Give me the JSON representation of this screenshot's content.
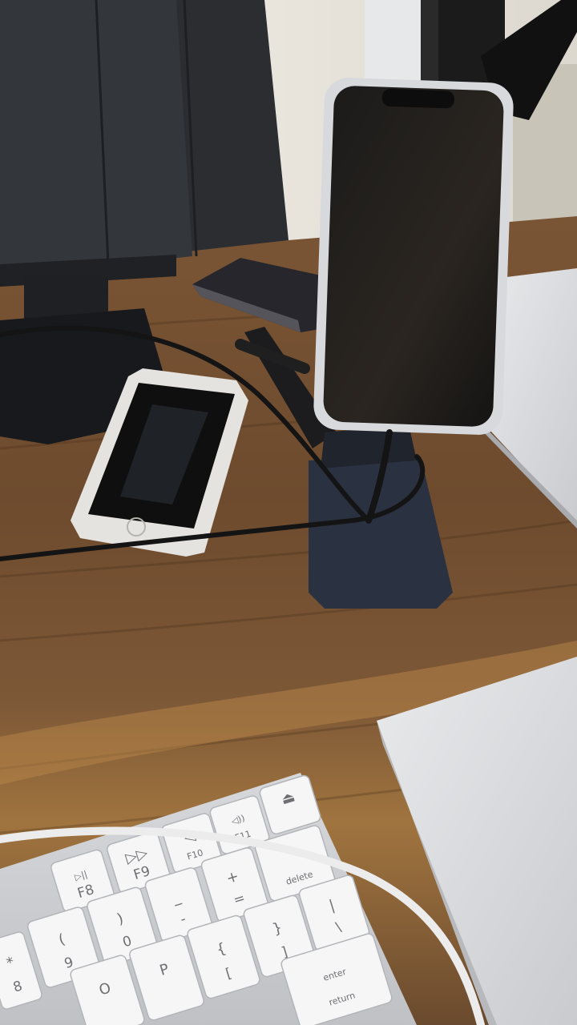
{
  "keyboard": {
    "keys": [
      {
        "main": "⏏",
        "sub": ""
      },
      {
        "main": "◁))",
        "sub": "F11"
      },
      {
        "main": "◁",
        "sub": "F10"
      },
      {
        "main": "▷▷",
        "sub": "F9"
      },
      {
        "main": "▷||",
        "sub": "F8"
      },
      {
        "main": "",
        "sub": "delete"
      },
      {
        "main": "+",
        "sub": "="
      },
      {
        "main": "_",
        "sub": "-"
      },
      {
        "main": ")",
        "sub": "0"
      },
      {
        "main": "(",
        "sub": "9"
      },
      {
        "main": "*",
        "sub": "8"
      },
      {
        "main": "|",
        "sub": "\\"
      },
      {
        "main": "}",
        "sub": "]"
      },
      {
        "main": "{",
        "sub": "["
      },
      {
        "main": "P",
        "sub": ""
      },
      {
        "main": "O",
        "sub": ""
      },
      {
        "main": "enter",
        "sub": "return"
      }
    ]
  }
}
